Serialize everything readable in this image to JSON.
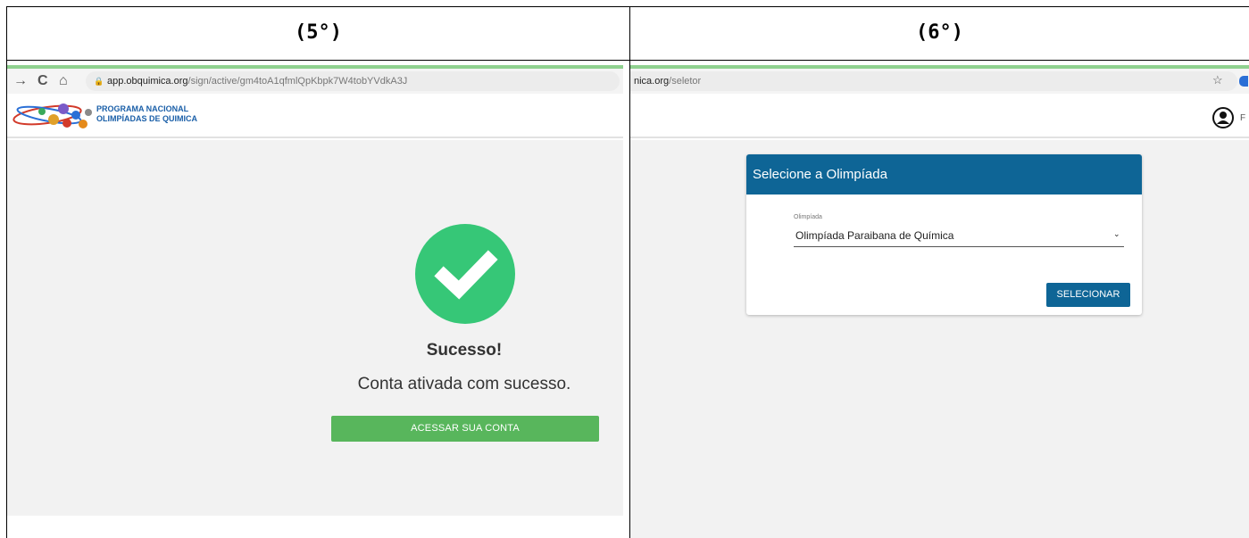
{
  "panels": {
    "left": {
      "label": "(5°)",
      "browser": {
        "url_domain": "app.obquimica.org",
        "url_path": "/sign/active/gm4toA1qfmlQpKbpk7W4tobYVdkA3J"
      },
      "brand": {
        "line1": "PROGRAMA NACIONAL",
        "line2": "OLIMPÍADAS DE QUIMICA"
      },
      "success": {
        "title": "Sucesso!",
        "message": "Conta ativada com sucesso.",
        "button_label": "ACESSAR SUA CONTA"
      }
    },
    "right": {
      "label": "(6°)",
      "browser": {
        "url_domain": "nica.org",
        "url_path": "/seletor"
      },
      "avatar_letter": "F",
      "card": {
        "title": "Selecione a Olimpíada",
        "select_label": "Olimpíada",
        "select_value": "Olimpíada Paraibana de Química",
        "button_label": "SELECIONAR"
      }
    }
  },
  "colors": {
    "success_green": "#36c777",
    "button_green": "#58b65c",
    "primary_blue": "#0e6596",
    "brand_blue": "#1a5fa8"
  },
  "icons": [
    "back-arrow-icon",
    "reload-icon",
    "home-icon",
    "lock-icon",
    "check-icon",
    "star-icon",
    "avatar-icon",
    "chevron-down-icon"
  ]
}
